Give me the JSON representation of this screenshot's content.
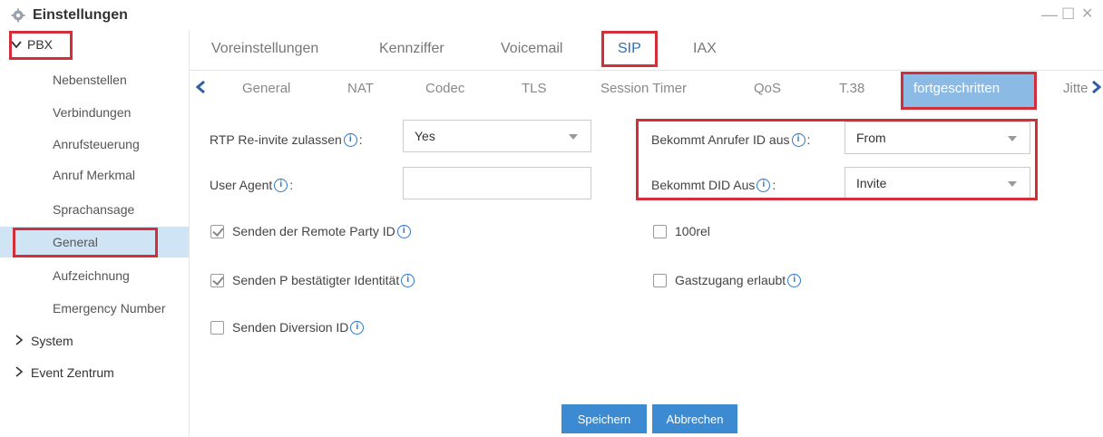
{
  "window": {
    "title": "Einstellungen",
    "minimize_icon": "—",
    "maximize_icon": "☐",
    "close_icon": "✕"
  },
  "sidebar": {
    "pbx": "PBX",
    "items": [
      "Nebenstellen",
      "Verbindungen",
      "Anrufsteuerung",
      "Anruf Merkmal",
      "Sprachansage",
      "General",
      "Aufzeichnung",
      "Emergency Number"
    ],
    "active_index": 5,
    "system": "System",
    "event": "Event Zentrum"
  },
  "tabs_top": [
    "Voreinstellungen",
    "Kennziffer",
    "Voicemail",
    "SIP",
    "IAX"
  ],
  "tabs_top_active": "SIP",
  "tabs_sub": [
    "General",
    "NAT",
    "Codec",
    "TLS",
    "Session Timer",
    "QoS",
    "T.38",
    "fortgeschritten",
    "Jitte"
  ],
  "tabs_sub_active": "fortgeschritten",
  "form": {
    "rtp_label": "RTP Re-invite zulassen",
    "rtp_value": "Yes",
    "agent_label": "User Agent",
    "agent_value": "",
    "callerid_label": "Bekommt Anrufer ID aus",
    "callerid_value": "From",
    "did_label": "Bekommt DID Aus",
    "did_value": "Invite",
    "colon": ":",
    "checks": {
      "remote_party": {
        "label": "Senden der Remote Party ID",
        "checked": true
      },
      "p_asserted": {
        "label": "Senden P bestätigter Identität",
        "checked": true
      },
      "diversion": {
        "label": "Senden Diversion ID",
        "checked": false
      },
      "rel100": {
        "label": "100rel",
        "checked": false
      },
      "guest": {
        "label": "Gastzugang erlaubt",
        "checked": false
      }
    }
  },
  "buttons": {
    "save": "Speichern",
    "cancel": "Abbrechen"
  },
  "colors": {
    "accent": "#3c8ad2",
    "highlight": "#d32f3a",
    "active_tab": "#8bbbe4",
    "sidebar_active": "#cfe5f6"
  }
}
